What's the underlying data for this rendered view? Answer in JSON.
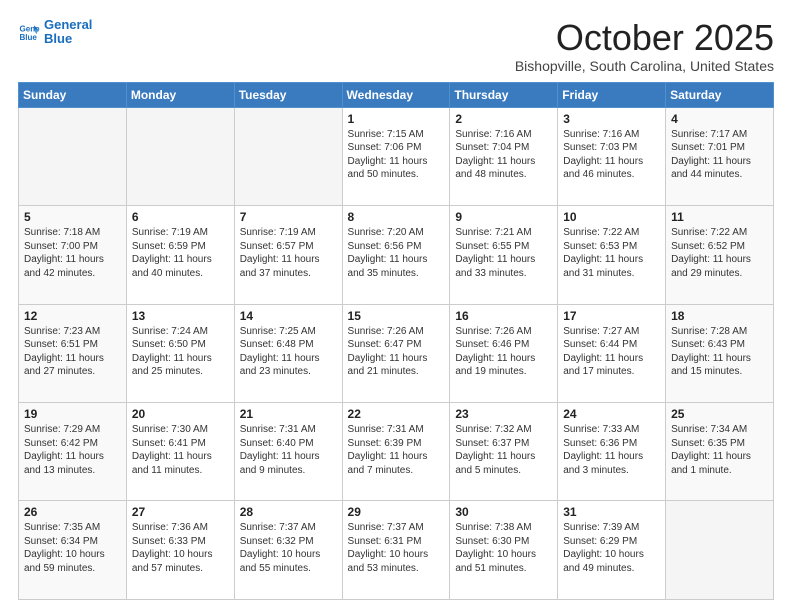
{
  "header": {
    "logo_line1": "General",
    "logo_line2": "Blue",
    "month": "October 2025",
    "location": "Bishopville, South Carolina, United States"
  },
  "weekdays": [
    "Sunday",
    "Monday",
    "Tuesday",
    "Wednesday",
    "Thursday",
    "Friday",
    "Saturday"
  ],
  "weeks": [
    [
      {
        "day": "",
        "text": ""
      },
      {
        "day": "",
        "text": ""
      },
      {
        "day": "",
        "text": ""
      },
      {
        "day": "1",
        "text": "Sunrise: 7:15 AM\nSunset: 7:06 PM\nDaylight: 11 hours\nand 50 minutes."
      },
      {
        "day": "2",
        "text": "Sunrise: 7:16 AM\nSunset: 7:04 PM\nDaylight: 11 hours\nand 48 minutes."
      },
      {
        "day": "3",
        "text": "Sunrise: 7:16 AM\nSunset: 7:03 PM\nDaylight: 11 hours\nand 46 minutes."
      },
      {
        "day": "4",
        "text": "Sunrise: 7:17 AM\nSunset: 7:01 PM\nDaylight: 11 hours\nand 44 minutes."
      }
    ],
    [
      {
        "day": "5",
        "text": "Sunrise: 7:18 AM\nSunset: 7:00 PM\nDaylight: 11 hours\nand 42 minutes."
      },
      {
        "day": "6",
        "text": "Sunrise: 7:19 AM\nSunset: 6:59 PM\nDaylight: 11 hours\nand 40 minutes."
      },
      {
        "day": "7",
        "text": "Sunrise: 7:19 AM\nSunset: 6:57 PM\nDaylight: 11 hours\nand 37 minutes."
      },
      {
        "day": "8",
        "text": "Sunrise: 7:20 AM\nSunset: 6:56 PM\nDaylight: 11 hours\nand 35 minutes."
      },
      {
        "day": "9",
        "text": "Sunrise: 7:21 AM\nSunset: 6:55 PM\nDaylight: 11 hours\nand 33 minutes."
      },
      {
        "day": "10",
        "text": "Sunrise: 7:22 AM\nSunset: 6:53 PM\nDaylight: 11 hours\nand 31 minutes."
      },
      {
        "day": "11",
        "text": "Sunrise: 7:22 AM\nSunset: 6:52 PM\nDaylight: 11 hours\nand 29 minutes."
      }
    ],
    [
      {
        "day": "12",
        "text": "Sunrise: 7:23 AM\nSunset: 6:51 PM\nDaylight: 11 hours\nand 27 minutes."
      },
      {
        "day": "13",
        "text": "Sunrise: 7:24 AM\nSunset: 6:50 PM\nDaylight: 11 hours\nand 25 minutes."
      },
      {
        "day": "14",
        "text": "Sunrise: 7:25 AM\nSunset: 6:48 PM\nDaylight: 11 hours\nand 23 minutes."
      },
      {
        "day": "15",
        "text": "Sunrise: 7:26 AM\nSunset: 6:47 PM\nDaylight: 11 hours\nand 21 minutes."
      },
      {
        "day": "16",
        "text": "Sunrise: 7:26 AM\nSunset: 6:46 PM\nDaylight: 11 hours\nand 19 minutes."
      },
      {
        "day": "17",
        "text": "Sunrise: 7:27 AM\nSunset: 6:44 PM\nDaylight: 11 hours\nand 17 minutes."
      },
      {
        "day": "18",
        "text": "Sunrise: 7:28 AM\nSunset: 6:43 PM\nDaylight: 11 hours\nand 15 minutes."
      }
    ],
    [
      {
        "day": "19",
        "text": "Sunrise: 7:29 AM\nSunset: 6:42 PM\nDaylight: 11 hours\nand 13 minutes."
      },
      {
        "day": "20",
        "text": "Sunrise: 7:30 AM\nSunset: 6:41 PM\nDaylight: 11 hours\nand 11 minutes."
      },
      {
        "day": "21",
        "text": "Sunrise: 7:31 AM\nSunset: 6:40 PM\nDaylight: 11 hours\nand 9 minutes."
      },
      {
        "day": "22",
        "text": "Sunrise: 7:31 AM\nSunset: 6:39 PM\nDaylight: 11 hours\nand 7 minutes."
      },
      {
        "day": "23",
        "text": "Sunrise: 7:32 AM\nSunset: 6:37 PM\nDaylight: 11 hours\nand 5 minutes."
      },
      {
        "day": "24",
        "text": "Sunrise: 7:33 AM\nSunset: 6:36 PM\nDaylight: 11 hours\nand 3 minutes."
      },
      {
        "day": "25",
        "text": "Sunrise: 7:34 AM\nSunset: 6:35 PM\nDaylight: 11 hours\nand 1 minute."
      }
    ],
    [
      {
        "day": "26",
        "text": "Sunrise: 7:35 AM\nSunset: 6:34 PM\nDaylight: 10 hours\nand 59 minutes."
      },
      {
        "day": "27",
        "text": "Sunrise: 7:36 AM\nSunset: 6:33 PM\nDaylight: 10 hours\nand 57 minutes."
      },
      {
        "day": "28",
        "text": "Sunrise: 7:37 AM\nSunset: 6:32 PM\nDaylight: 10 hours\nand 55 minutes."
      },
      {
        "day": "29",
        "text": "Sunrise: 7:37 AM\nSunset: 6:31 PM\nDaylight: 10 hours\nand 53 minutes."
      },
      {
        "day": "30",
        "text": "Sunrise: 7:38 AM\nSunset: 6:30 PM\nDaylight: 10 hours\nand 51 minutes."
      },
      {
        "day": "31",
        "text": "Sunrise: 7:39 AM\nSunset: 6:29 PM\nDaylight: 10 hours\nand 49 minutes."
      },
      {
        "day": "",
        "text": ""
      }
    ]
  ]
}
